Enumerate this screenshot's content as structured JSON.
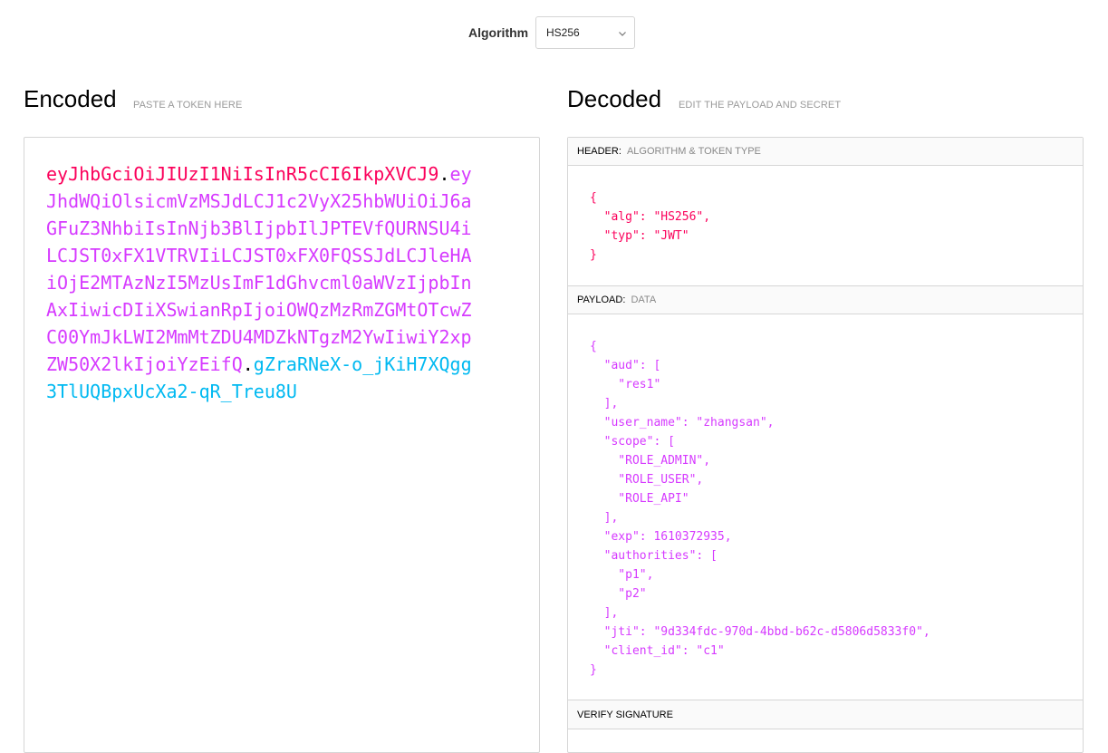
{
  "algorithm": {
    "label": "Algorithm",
    "selected": "HS256",
    "chevron_icon": "chevron-down-icon"
  },
  "encoded": {
    "title": "Encoded",
    "subtitle": "PASTE A TOKEN HERE",
    "header_part": "eyJhbGciOiJIUzI1NiIsInR5cCI6IkpXVCJ9",
    "payload_part": "eyJhdWQiOlsicmVzMSJdLCJ1c2VyX25hbWUiOiJ6aGFuZ3NhbiIsInNjb3BlIjpbIlJPTEVfQURNSU4iLCJST0xFX1VTRVIiLCJST0xFX0FQSSJdLCJleHAiOjE2MTAzNzI5MzUsImF1dGhvcml0aWVzIjpbInAxIiwicDIiXSwianRpIjoiOWQzMzRmZGMtOTcwZC00YmJkLWI2MmMtZDU4MDZkNTgzM2YwIiwiY2xpZW50X2lkIjoiYzEifQ",
    "signature_part": "gZraRNeX-o_jKiH7XQgg3TlUQBpxUcXa2-qR_Treu8U",
    "dot": "."
  },
  "decoded": {
    "title": "Decoded",
    "subtitle": "EDIT THE PAYLOAD AND SECRET",
    "header_section": {
      "label": "HEADER:",
      "sub": "ALGORITHM & TOKEN TYPE",
      "json": "{\n  \"alg\": \"HS256\",\n  \"typ\": \"JWT\"\n}"
    },
    "payload_section": {
      "label": "PAYLOAD:",
      "sub": "DATA",
      "json": "{\n  \"aud\": [\n    \"res1\"\n  ],\n  \"user_name\": \"zhangsan\",\n  \"scope\": [\n    \"ROLE_ADMIN\",\n    \"ROLE_USER\",\n    \"ROLE_API\"\n  ],\n  \"exp\": 1610372935,\n  \"authorities\": [\n    \"p1\",\n    \"p2\"\n  ],\n  \"jti\": \"9d334fdc-970d-4bbd-b62c-d5806d5833f0\",\n  \"client_id\": \"c1\"\n}"
    },
    "verify_section": {
      "label": "VERIFY SIGNATURE"
    }
  },
  "colors": {
    "header": "#fb015b",
    "payload": "#d63aff",
    "signature": "#00b9f1"
  }
}
